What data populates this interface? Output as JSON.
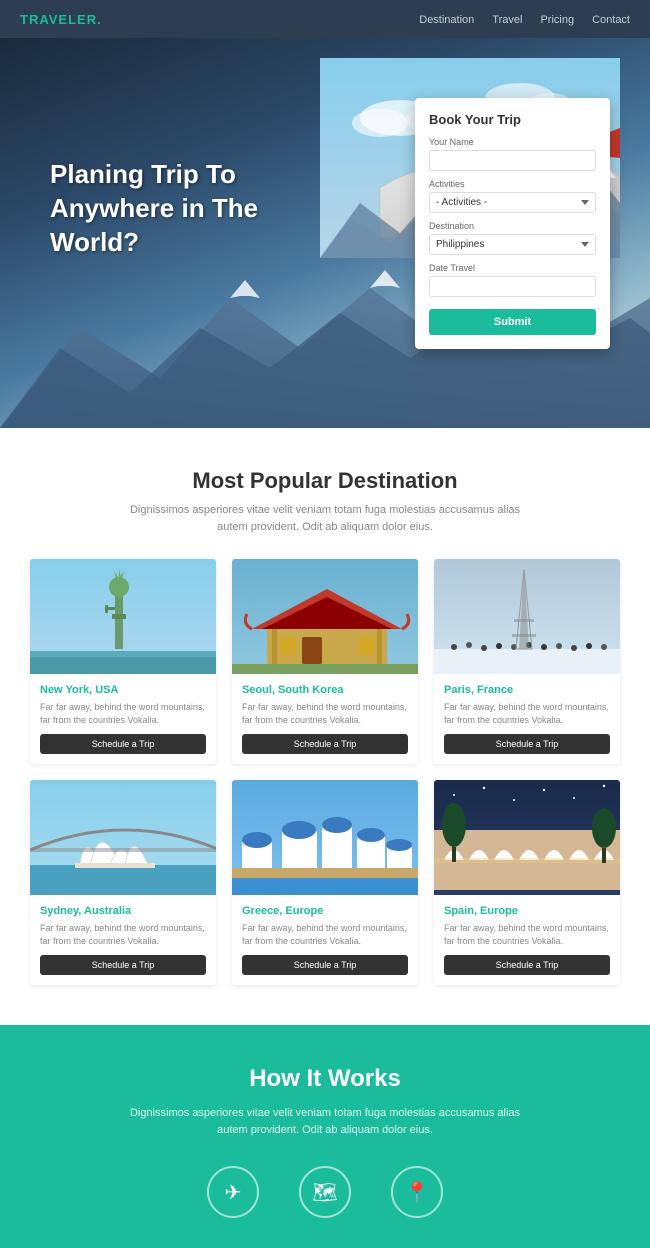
{
  "navbar": {
    "brand": "TRAVELER",
    "brand_dot": ".",
    "nav_items": [
      "Destination",
      "Travel",
      "Pricing",
      "Contact"
    ]
  },
  "hero": {
    "headline_line1": "Planing Trip To",
    "headline_line2": "Anywhere in The",
    "headline_line3": "World?"
  },
  "booking": {
    "title": "Book Your Trip",
    "your_name_label": "Your Name",
    "your_name_placeholder": "",
    "activities_label": "Activities",
    "activities_default": "- Activities -",
    "destination_label": "Destination",
    "destination_default": "Philippines",
    "date_label": "Date Travel",
    "date_placeholder": "",
    "submit_label": "Submit"
  },
  "destinations": {
    "section_title": "Most Popular Destination",
    "section_desc": "Dignissimos asperiores vitae velit veniam totam fuga molestias accusamus alias autem provident. Odit ab aliquam dolor eius.",
    "cards": [
      {
        "title": "New York, USA",
        "desc": "Far far away, behind the word mountains, far from the countries Vokalia.",
        "btn": "Schedule a Trip",
        "color_scheme": "sky"
      },
      {
        "title": "Seoul, South Korea",
        "desc": "Far far away, behind the word mountains, far from the countries Vokalia.",
        "btn": "Schedule a Trip",
        "color_scheme": "asian"
      },
      {
        "title": "Paris, France",
        "desc": "Far far away, behind the word mountains, far from the countries Vokalia.",
        "btn": "Schedule a Trip",
        "color_scheme": "winter"
      },
      {
        "title": "Sydney, Australia",
        "desc": "Far far away, behind the word mountains, far from the countries Vokalia.",
        "btn": "Schedule a Trip",
        "color_scheme": "opera"
      },
      {
        "title": "Greece, Europe",
        "desc": "Far far away, behind the word mountains, far from the countries Vokalia.",
        "btn": "Schedule a Trip",
        "color_scheme": "white"
      },
      {
        "title": "Spain, Europe",
        "desc": "Far far away, behind the word mountains, far from the countries Vokalia.",
        "btn": "Schedule a Trip",
        "color_scheme": "night"
      }
    ]
  },
  "how_it_works": {
    "title": "How It Works",
    "desc": "Dignissimos asperiores vitae velit veniam totam fuga molestias accusamus alias autem provident. Odit ab aliquam dolor eius.",
    "icons": [
      "✈",
      "🗺",
      "📍"
    ]
  }
}
